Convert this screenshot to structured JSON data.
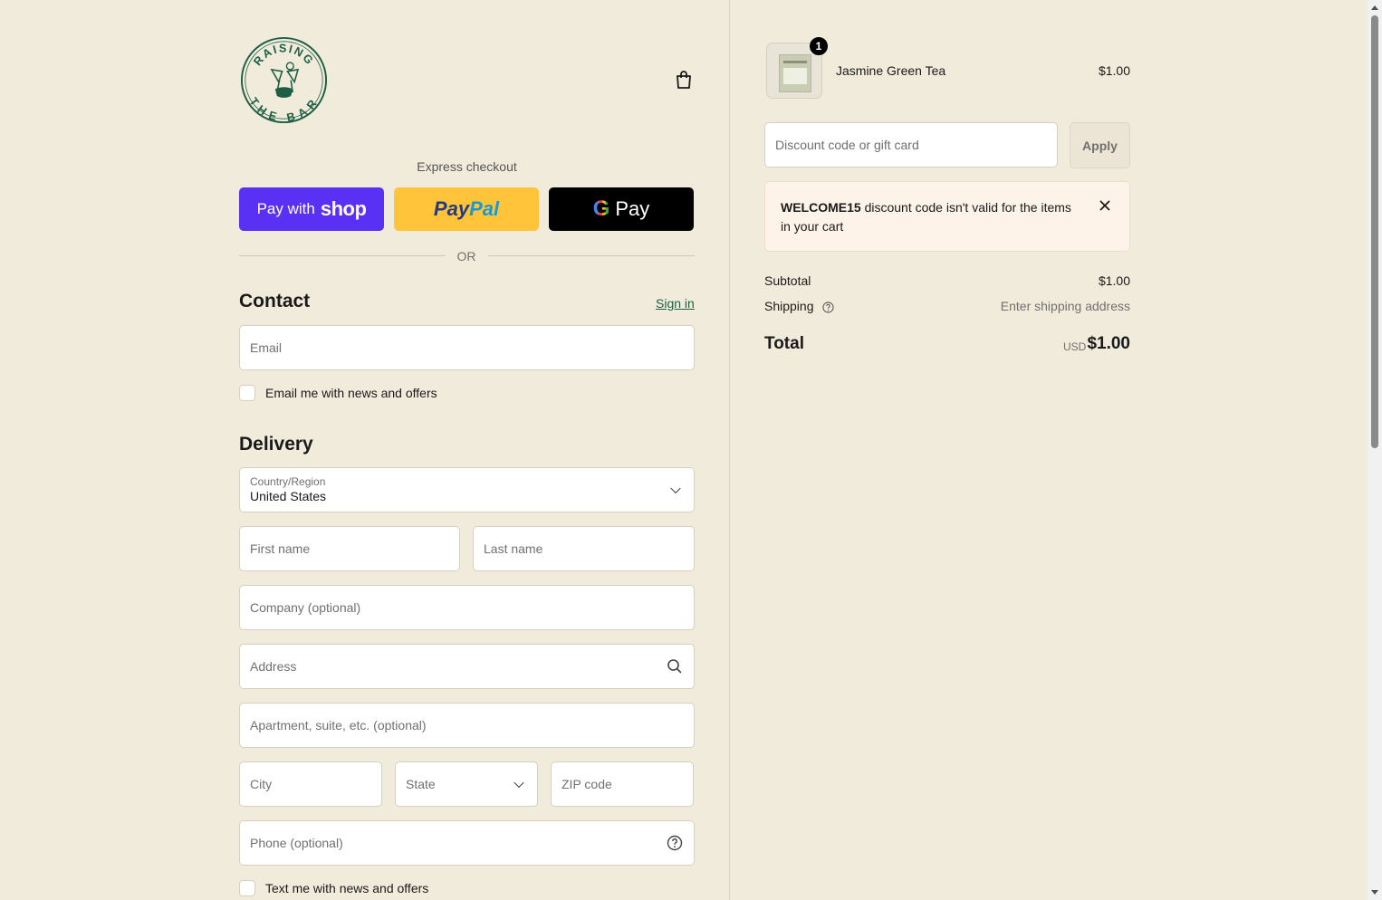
{
  "brand": {
    "logo_top_text": "RAISING",
    "logo_bottom_text": "THE BAR"
  },
  "express": {
    "title": "Express checkout",
    "shop_pay_prefix": "Pay with",
    "shop_pay_word": "shop",
    "paypal_part1": "Pay",
    "paypal_part2": "Pal",
    "gpay_g": "G",
    "gpay_label": "Pay",
    "or_label": "OR"
  },
  "contact": {
    "title": "Contact",
    "sign_in": "Sign in",
    "email_placeholder": "Email",
    "news_checkbox": "Email me with news and offers"
  },
  "delivery": {
    "title": "Delivery",
    "country_label": "Country/Region",
    "country_value": "United States",
    "first_name_placeholder": "First name",
    "last_name_placeholder": "Last name",
    "company_placeholder": "Company (optional)",
    "address_placeholder": "Address",
    "apartment_placeholder": "Apartment, suite, etc. (optional)",
    "city_placeholder": "City",
    "state_placeholder": "State",
    "zip_placeholder": "ZIP code",
    "phone_placeholder": "Phone (optional)",
    "sms_checkbox": "Text me with news and offers"
  },
  "order": {
    "item": {
      "name": "Jasmine Green Tea",
      "price": "$1.00",
      "quantity": "1"
    },
    "discount_placeholder": "Discount code or gift card",
    "apply_label": "Apply",
    "notice_code": "WELCOME15",
    "notice_text": " discount code isn't valid for the items in your cart",
    "subtotal_label": "Subtotal",
    "subtotal_value": "$1.00",
    "shipping_label": "Shipping",
    "shipping_value": "Enter shipping address",
    "total_label": "Total",
    "total_currency": "USD",
    "total_value": "$1.00"
  },
  "colors": {
    "background": "#f1ebdc",
    "shop_pay": "#5a31f4",
    "paypal": "#ffc439",
    "gpay": "#000000",
    "brand_green": "#1d5e45",
    "notice_bg": "#fdf3e9"
  }
}
